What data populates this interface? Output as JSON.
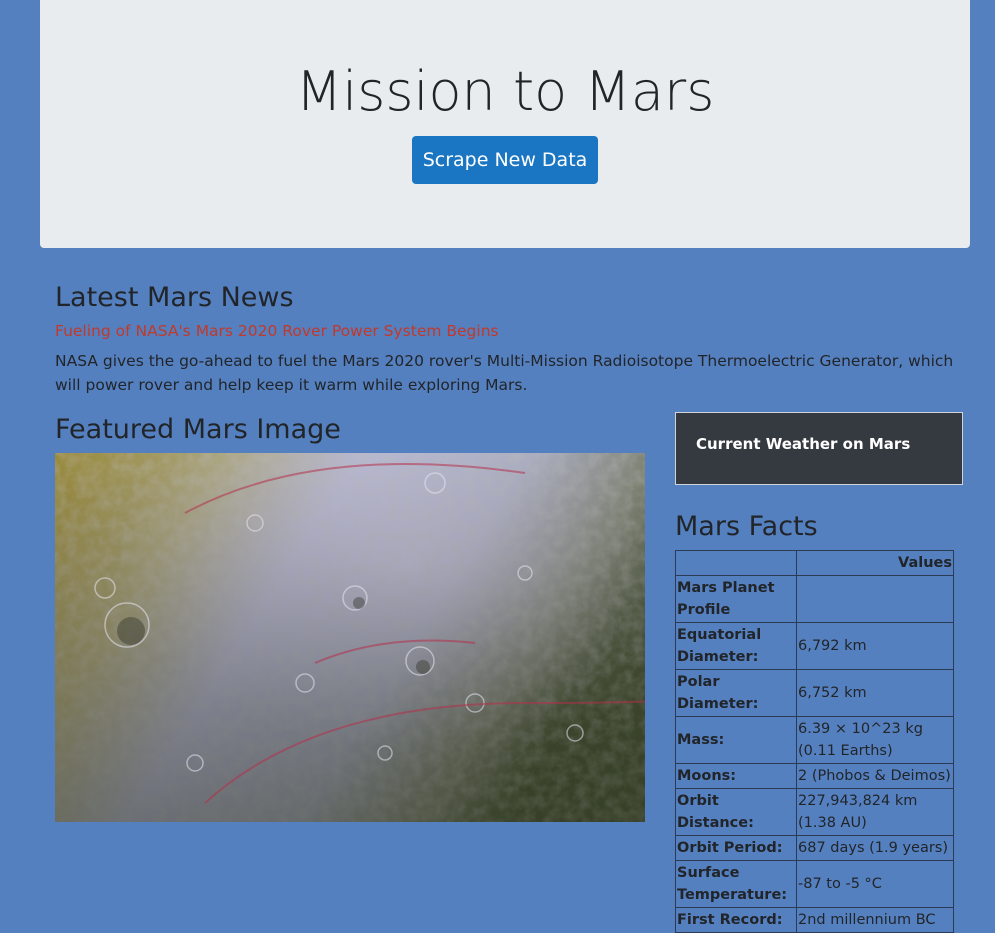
{
  "header": {
    "title": "Mission to Mars",
    "scrape_button": "Scrape New Data"
  },
  "news": {
    "heading": "Latest Mars News",
    "title": "Fueling of NASA's Mars 2020 Rover Power System Begins",
    "paragraph": "NASA gives the go-ahead to fuel the Mars 2020 rover's Multi-Mission Radioisotope Thermoelectric Generator, which will power rover and help keep it warm while exploring Mars."
  },
  "featured": {
    "heading": "Featured Mars Image"
  },
  "weather": {
    "heading": "Current Weather on Mars"
  },
  "facts": {
    "heading": "Mars Facts",
    "column_header": "Values",
    "rows": [
      {
        "label": "Mars Planet Profile",
        "value": ""
      },
      {
        "label": "Equatorial Diameter:",
        "value": "6,792 km"
      },
      {
        "label": "Polar Diameter:",
        "value": "6,752 km"
      },
      {
        "label": "Mass:",
        "value": "6.39 × 10^23 kg (0.11 Earths)"
      },
      {
        "label": "Moons:",
        "value": "2 (Phobos & Deimos)"
      },
      {
        "label": "Orbit Distance:",
        "value": "227,943,824 km (1.38 AU)"
      },
      {
        "label": "Orbit Period:",
        "value": "687 days (1.9 years)"
      },
      {
        "label": "Surface Temperature:",
        "value": "-87 to -5 °C"
      },
      {
        "label": "First Record:",
        "value": "2nd millennium BC"
      }
    ]
  }
}
